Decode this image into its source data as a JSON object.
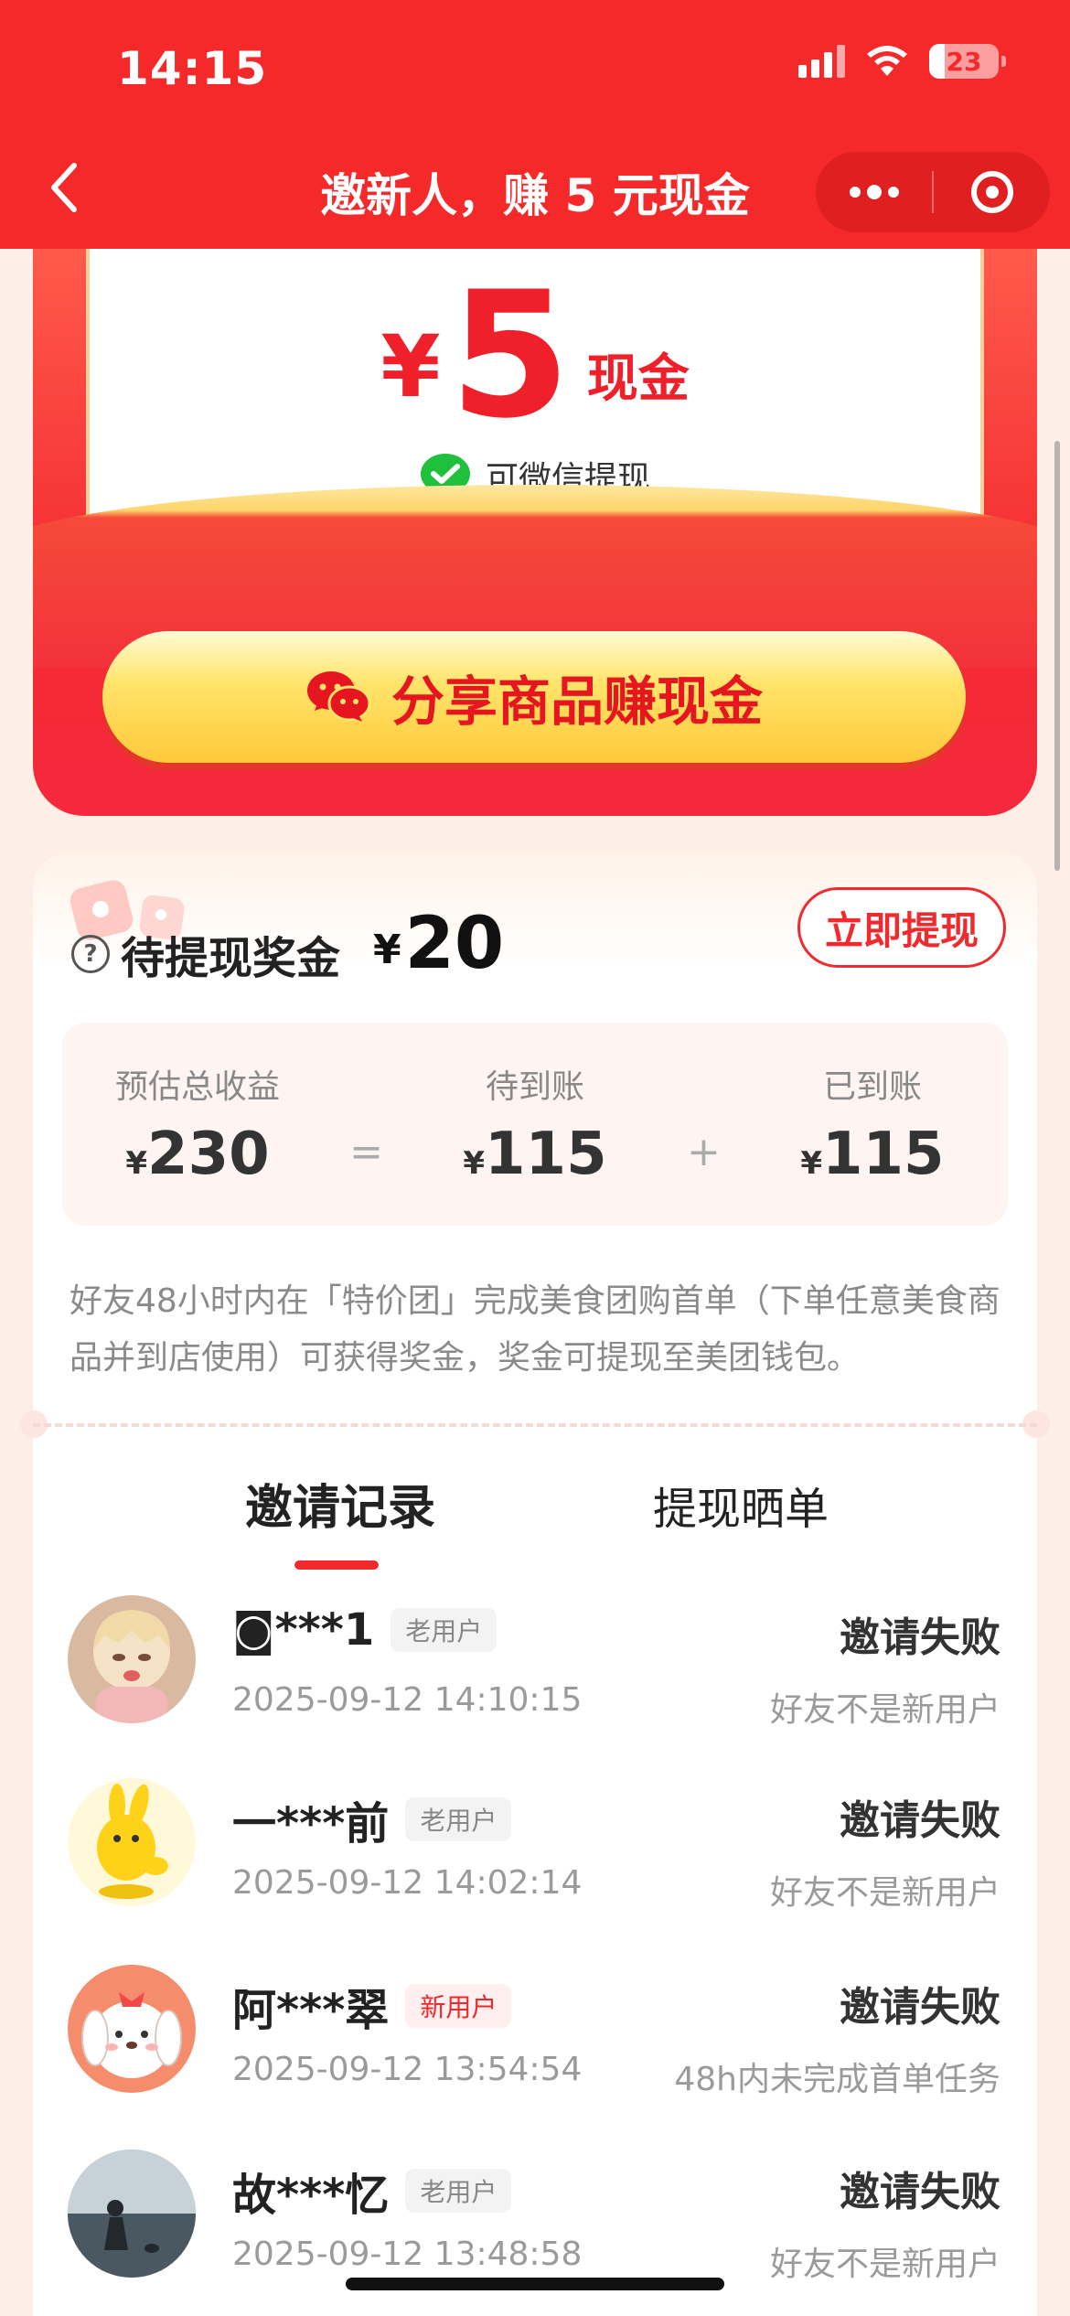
{
  "status_bar": {
    "time": "14:15",
    "battery": "23",
    "battery_level": 0.23
  },
  "nav": {
    "title": "邀新人，赚 5 元现金"
  },
  "envelope": {
    "currency": "¥",
    "amount": "5",
    "unit": "现金",
    "wechat_note": "可微信提现",
    "share_button": "分享商品赚现金"
  },
  "bonus": {
    "label": "待提现奖金",
    "currency": "¥",
    "value": "20",
    "withdraw_button": "立即提现",
    "earnings": {
      "total_label": "预估总收益",
      "total_value": "230",
      "pending_label": "待到账",
      "pending_value": "115",
      "received_label": "已到账",
      "received_value": "115",
      "currency": "¥",
      "eq": "=",
      "plus": "+"
    },
    "rule_text": "好友48小时内在「特价团」完成美食团购首单（下单任意美食商品并到店使用）可获得奖金，奖金可提现至美团钱包。"
  },
  "tabs": [
    {
      "label": "邀请记录",
      "active": true
    },
    {
      "label": "提现晒单",
      "active": false
    }
  ],
  "records": [
    {
      "name": "◙***1",
      "tag": "老用户",
      "tag_type": "old",
      "time": "2025-09-12 14:10:15",
      "status": "邀请失败",
      "reason": "好友不是新用户"
    },
    {
      "name": "一***前",
      "tag": "老用户",
      "tag_type": "old",
      "time": "2025-09-12 14:02:14",
      "status": "邀请失败",
      "reason": "好友不是新用户"
    },
    {
      "name": "阿***翠",
      "tag": "新用户",
      "tag_type": "new",
      "time": "2025-09-12 13:54:54",
      "status": "邀请失败",
      "reason": "48h内未完成首单任务"
    },
    {
      "name": "故***忆",
      "tag": "老用户",
      "tag_type": "old",
      "time": "2025-09-12 13:48:58",
      "status": "邀请失败",
      "reason": "好友不是新用户"
    }
  ],
  "colors": {
    "brand_red": "#f5282a",
    "button_yellow": "#ffd84a"
  }
}
